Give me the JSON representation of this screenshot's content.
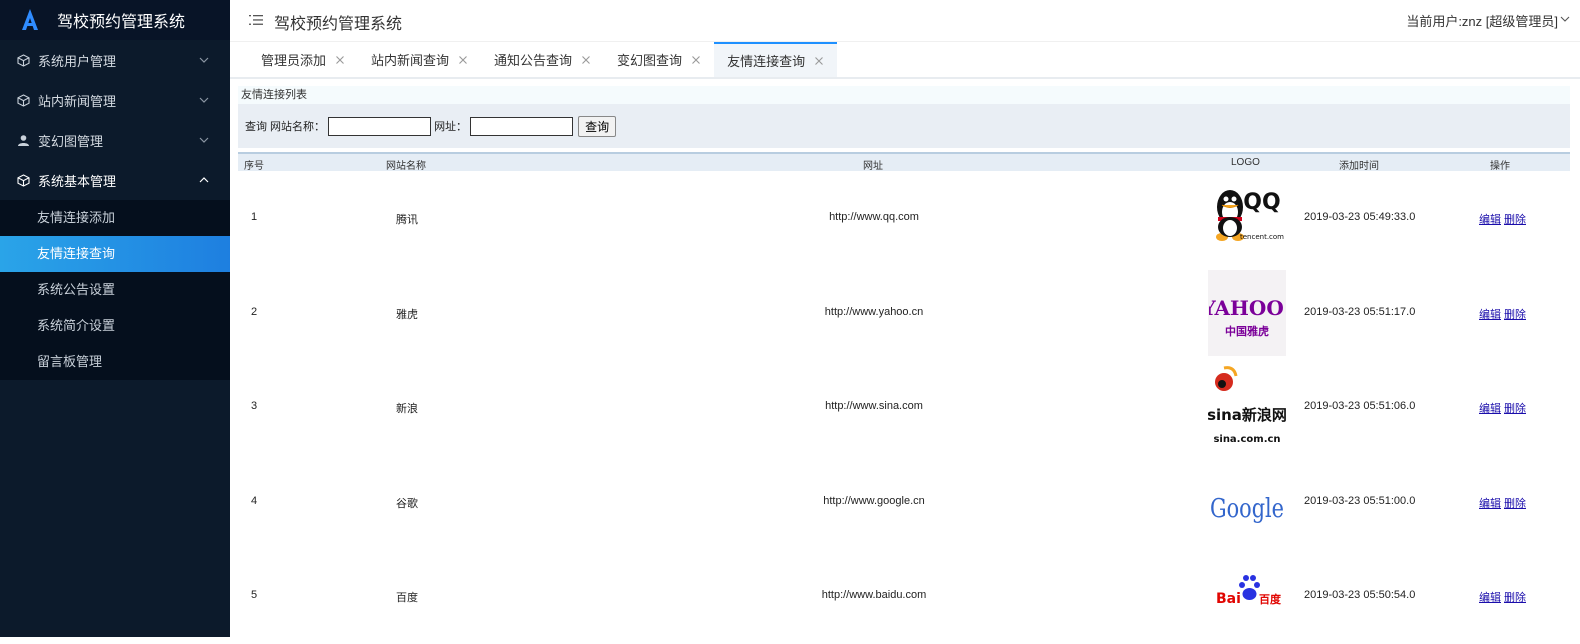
{
  "app": {
    "title": "驾校预约管理系统",
    "logo_icon": "a-logo-icon",
    "accent": "#2a8ee8"
  },
  "sidebar": {
    "groups": [
      {
        "label": "系统用户管理",
        "icon": "cube-icon",
        "open": false
      },
      {
        "label": "站内新闻管理",
        "icon": "cube-icon",
        "open": false
      },
      {
        "label": "变幻图管理",
        "icon": "user-icon",
        "open": false
      },
      {
        "label": "系统基本管理",
        "icon": "cube-icon",
        "open": true
      }
    ],
    "subitems": [
      {
        "label": "友情连接添加",
        "active": false
      },
      {
        "label": "友情连接查询",
        "active": true
      },
      {
        "label": "系统公告设置",
        "active": false
      },
      {
        "label": "系统简介设置",
        "active": false
      },
      {
        "label": "留言板管理",
        "active": false
      }
    ]
  },
  "header": {
    "title": "驾校预约管理系统",
    "user": "当前用户:znz [超级管理员]"
  },
  "tabs": [
    {
      "label": "管理员添加",
      "active": false
    },
    {
      "label": "站内新闻查询",
      "active": false
    },
    {
      "label": "通知公告查询",
      "active": false
    },
    {
      "label": "变幻图查询",
      "active": false
    },
    {
      "label": "友情连接查询",
      "active": true
    }
  ],
  "panel": {
    "title": "友情连接列表",
    "search": {
      "prefix": "查询 网站名称：",
      "url_label": "网址：",
      "name_value": "",
      "url_value": "",
      "button": "查询"
    }
  },
  "table": {
    "headers": {
      "no": "序号",
      "name": "网站名称",
      "url": "网址",
      "logo": "LOGO",
      "time": "添加时间",
      "op": "操作"
    },
    "edit_label": "编辑",
    "delete_label": "删除",
    "rows": [
      {
        "no": "1",
        "name": "腾讯",
        "url": "http://www.qq.com",
        "logo": "qq-logo",
        "time": "2019-03-23 05:49:33.0"
      },
      {
        "no": "2",
        "name": "雅虎",
        "url": "http://www.yahoo.cn",
        "logo": "yahoo-logo",
        "time": "2019-03-23 05:51:17.0"
      },
      {
        "no": "3",
        "name": "新浪",
        "url": "http://www.sina.com",
        "logo": "sina-logo",
        "time": "2019-03-23 05:51:06.0"
      },
      {
        "no": "4",
        "name": "谷歌",
        "url": "http://www.google.cn",
        "logo": "google-logo",
        "time": "2019-03-23 05:51:00.0"
      },
      {
        "no": "5",
        "name": "百度",
        "url": "http://www.baidu.com",
        "logo": "baidu-logo",
        "time": "2019-03-23 05:50:54.0"
      }
    ],
    "logo_text": {
      "qq": {
        "main": "QQ",
        "sub": "tencent.com"
      },
      "yahoo": {
        "main": "YAHOO!",
        "sub": "中国雅虎"
      },
      "sina": {
        "main": "sina新浪网",
        "sub": "sina.com.cn"
      },
      "google": {
        "main": "Google"
      },
      "baidu": {
        "main": "Bai",
        "sub": "百度"
      }
    }
  }
}
